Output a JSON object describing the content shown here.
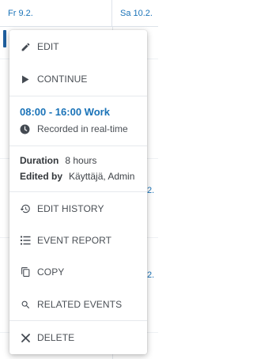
{
  "calendar": {
    "day_friday": "Fr 9.2.",
    "day_saturday": "Sa 10.2.",
    "peek_dates": [
      "2.",
      "2."
    ]
  },
  "menu": {
    "edit_label": "EDIT",
    "continue_label": "CONTINUE",
    "event_time": "08:00 - 16:00 Work",
    "recorded_text": "Recorded in real-time",
    "duration_key": "Duration",
    "duration_value": "8 hours",
    "edited_by_key": "Edited by",
    "edited_by_value": "Käyttäjä, Admin",
    "edit_history_label": "EDIT HISTORY",
    "event_report_label": "EVENT REPORT",
    "copy_label": "COPY",
    "related_events_label": "RELATED EVENTS",
    "delete_label": "DELETE"
  },
  "colors": {
    "accent": "#1a73b8",
    "icon": "#444a52",
    "text": "#4a4f55"
  },
  "icons": {
    "edit": "pencil-icon",
    "continue": "play-icon",
    "recorded": "clock-icon",
    "edit_history": "history-icon",
    "event_report": "list-icon",
    "copy": "copy-icon",
    "related_events": "search-icon",
    "delete": "close-icon"
  }
}
